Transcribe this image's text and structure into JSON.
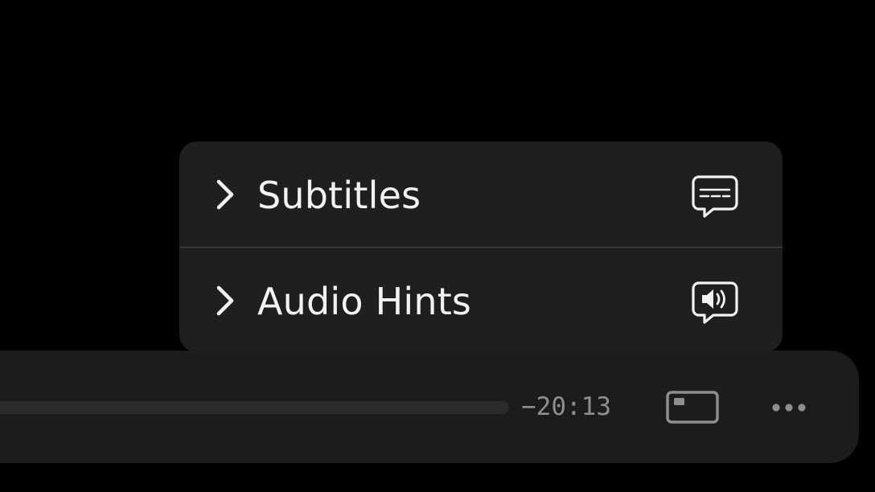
{
  "menu": {
    "items": [
      {
        "label": "Subtitles",
        "icon": "subtitles-icon"
      },
      {
        "label": "Audio Hints",
        "icon": "audio-hints-icon"
      }
    ]
  },
  "player": {
    "time_remaining": "−20:13",
    "controls": [
      "picture-in-picture-icon",
      "more-options-icon"
    ]
  },
  "colors": {
    "background": "#000000",
    "menu_bg": "#1f1f1f",
    "bar_bg": "#1c1c1c",
    "text": "#f2f2f2",
    "muted_text": "#8e8e8e"
  }
}
